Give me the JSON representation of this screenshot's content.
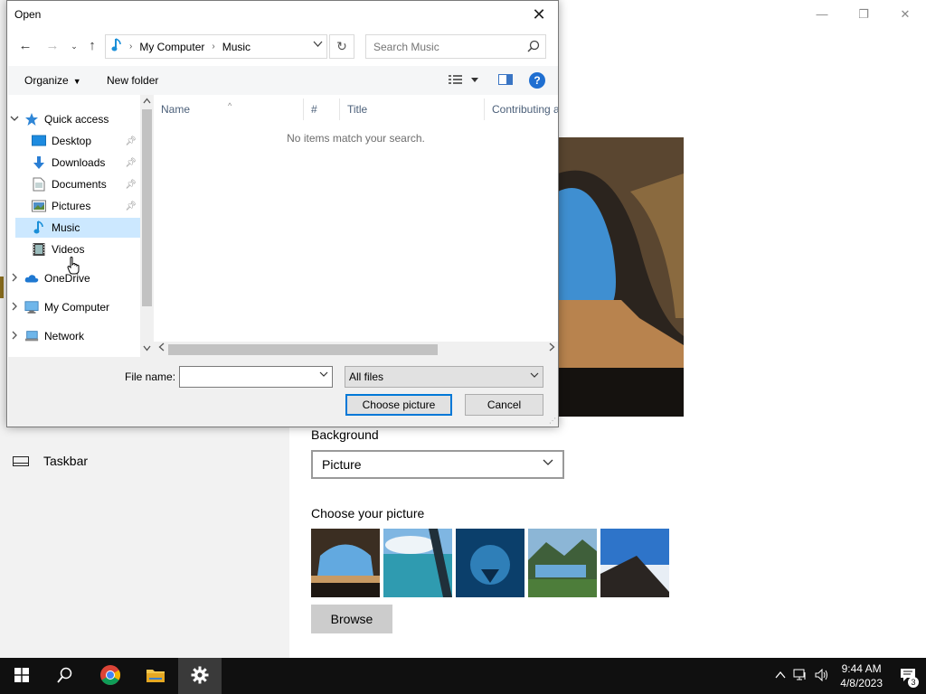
{
  "settings": {
    "nav_taskbar_label": "Taskbar",
    "background_label": "Background",
    "background_value": "Picture",
    "choose_label": "Choose your picture",
    "browse_label": "Browse",
    "window_controls": {
      "minimize": "—",
      "restore": "❐",
      "close": "✕"
    }
  },
  "dialog": {
    "title": "Open",
    "close_glyph": "✕",
    "address": {
      "root": "My Computer",
      "folder": "Music"
    },
    "search_placeholder": "Search Music",
    "toolbar": {
      "organize": "Organize",
      "new_folder": "New folder",
      "help": "?"
    },
    "nav": {
      "quick_access": "Quick access",
      "desktop": "Desktop",
      "downloads": "Downloads",
      "documents": "Documents",
      "pictures": "Pictures",
      "music": "Music",
      "videos": "Videos",
      "onedrive": "OneDrive",
      "my_computer": "My Computer",
      "network": "Network"
    },
    "columns": {
      "name": "Name",
      "number": "#",
      "title": "Title",
      "contributing": "Contributing artists"
    },
    "empty_message": "No items match your search.",
    "file_name_label": "File name:",
    "file_name_value": "",
    "filter_value": "All files",
    "choose_button": "Choose picture",
    "cancel_button": "Cancel"
  },
  "taskbar": {
    "time": "9:44 AM",
    "date": "4/8/2023",
    "notification_count": "3"
  },
  "colors": {
    "accent": "#0078d7",
    "taskbar": "#101010",
    "selected": "#cce8ff"
  }
}
